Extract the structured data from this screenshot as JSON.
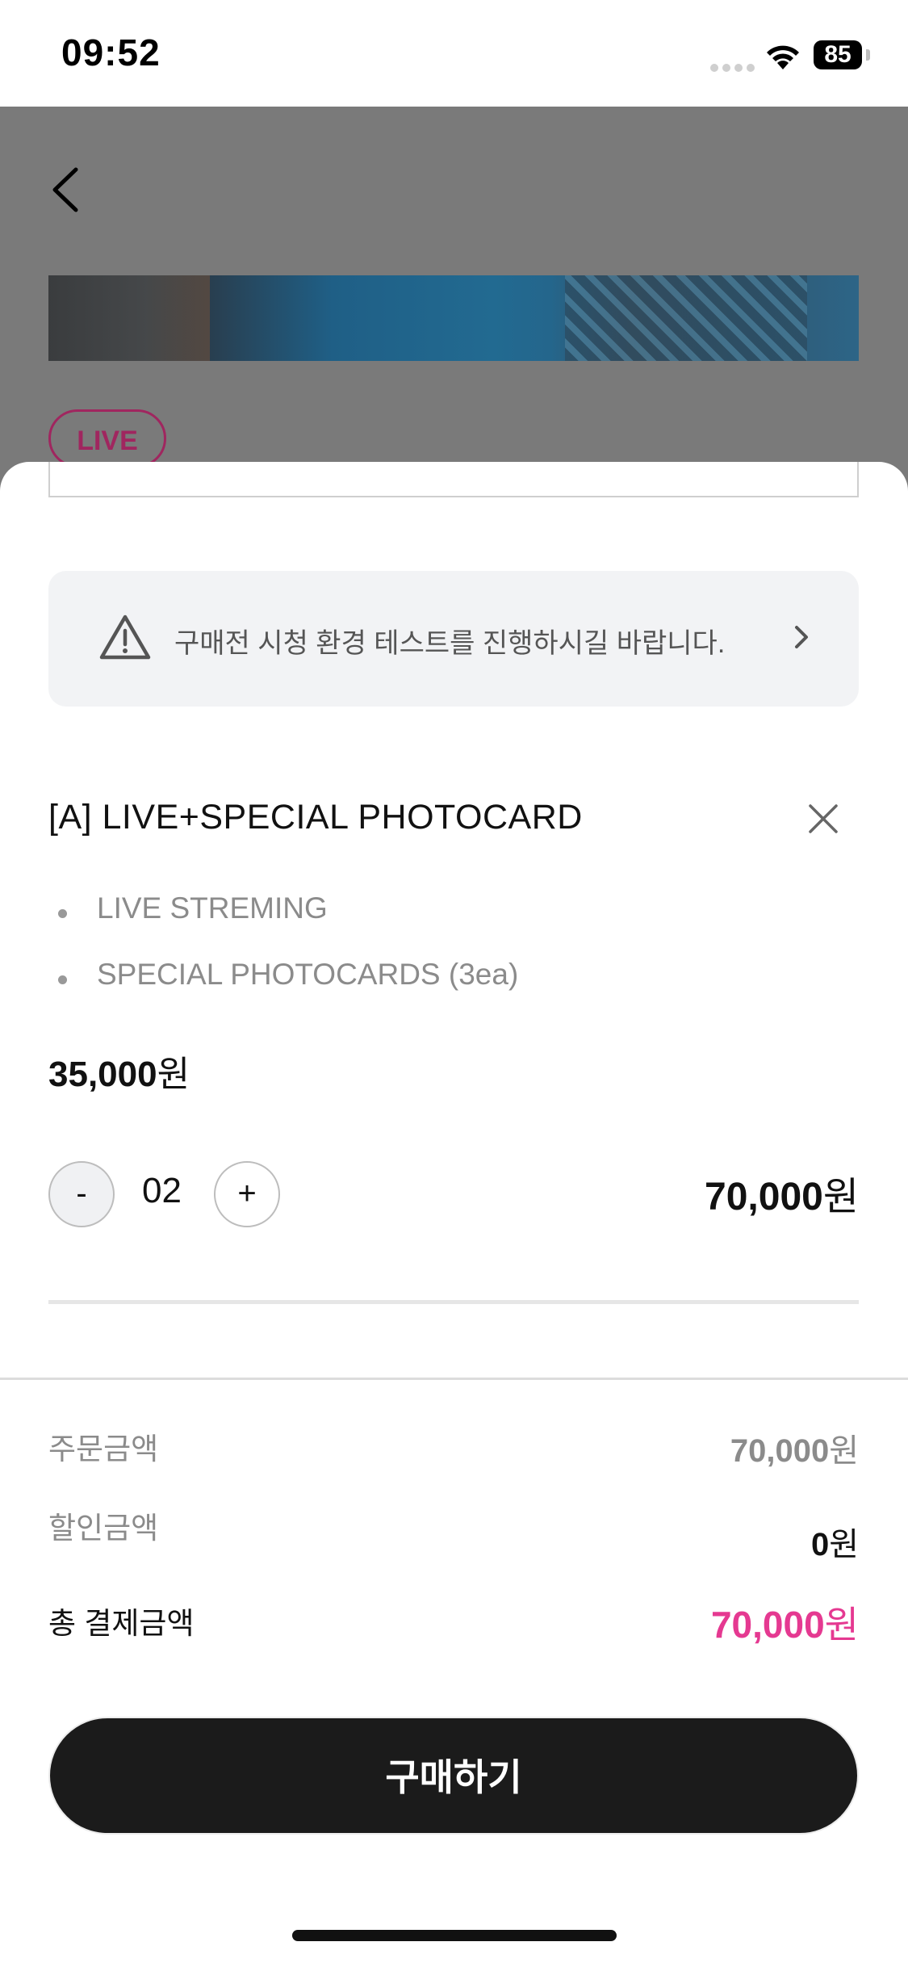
{
  "status_bar": {
    "time": "09:52",
    "battery": "85"
  },
  "background_page": {
    "live_tag": "LIVE"
  },
  "notice": {
    "text": "구매전 시청 환경 테스트를 진행하시길 바랍니다."
  },
  "product": {
    "title": "[A] LIVE+SPECIAL PHOTOCARD",
    "features": [
      "LIVE STREMING",
      "SPECIAL PHOTOCARDS (3ea)"
    ],
    "unit_price_number": "35,000",
    "currency": "원",
    "quantity": "02",
    "minus_label": "-",
    "plus_label": "+",
    "line_total_number": "70,000"
  },
  "summary": {
    "order_amount_label": "주문금액",
    "order_amount_number": "70,000",
    "discount_label": "할인금액",
    "discount_number": "0",
    "total_label": "총 결제금액",
    "total_number": "70,000",
    "currency": "원"
  },
  "buy_button": {
    "label": "구매하기"
  },
  "icons": {
    "back": "chevron-left-icon",
    "warning": "warning-triangle-icon",
    "chevron": "chevron-right-icon",
    "close": "close-icon"
  },
  "colors": {
    "accent_total": "#e53991",
    "live_tag": "#a0265f",
    "button_bg": "#1b1b1b"
  }
}
